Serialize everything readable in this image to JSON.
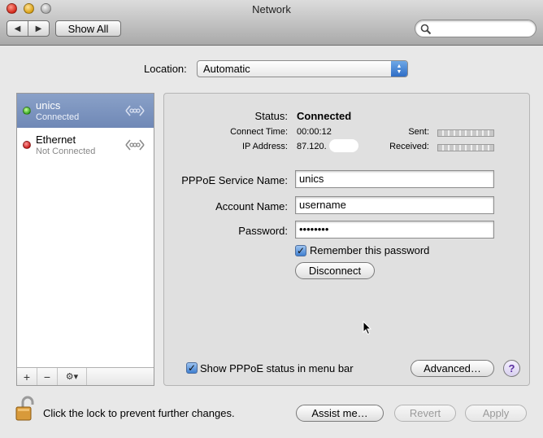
{
  "window": {
    "title": "Network"
  },
  "toolbar": {
    "back_icon": "left-arrow-icon",
    "forward_icon": "right-arrow-icon",
    "show_all_label": "Show All",
    "search_placeholder": ""
  },
  "location": {
    "label": "Location:",
    "value": "Automatic"
  },
  "services": [
    {
      "name": "unics",
      "status": "Connected",
      "status_color": "#2ea21a",
      "selected": true
    },
    {
      "name": "Ethernet",
      "status": "Not Connected",
      "status_color": "#c41414",
      "selected": false
    }
  ],
  "service_toolbar": {
    "add": "+",
    "remove": "−",
    "action": "⚙▾"
  },
  "details": {
    "status_label": "Status:",
    "status_value": "Connected",
    "connect_time_label": "Connect Time:",
    "connect_time_value": "00:00:12",
    "ip_label": "IP Address:",
    "ip_value": "87.120.",
    "sent_label": "Sent:",
    "received_label": "Received:",
    "service_name_label": "PPPoE Service Name:",
    "service_name_value": "unics",
    "account_label": "Account Name:",
    "account_value": "username",
    "password_label": "Password:",
    "password_value": "••••••••",
    "remember_label": "Remember this password",
    "remember_checked": true,
    "disconnect_label": "Disconnect",
    "show_status_label": "Show PPPoE status in menu bar",
    "show_status_checked": true,
    "advanced_label": "Advanced…",
    "help_label": "?"
  },
  "footer": {
    "lock_text": "Click the lock to prevent further changes.",
    "assist_label": "Assist me…",
    "revert_label": "Revert",
    "apply_label": "Apply"
  }
}
